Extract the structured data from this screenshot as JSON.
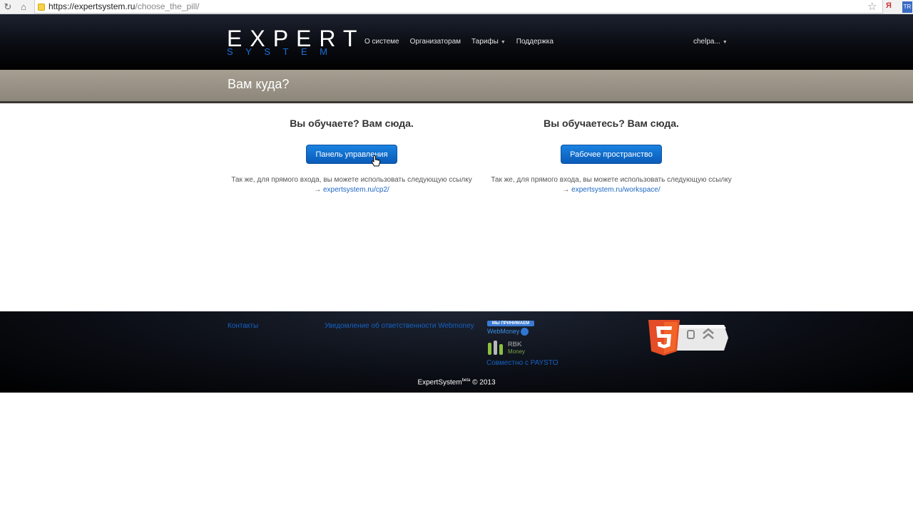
{
  "browser": {
    "url_host": "https://expertsystem.ru",
    "url_path": "/choose_the_pill/",
    "ext1": "Я",
    "ext2": "TR"
  },
  "header": {
    "logo_top": "EXPERT",
    "logo_bottom": "SYSTEM",
    "nav": [
      "О системе",
      "Организаторам",
      "Тарифы",
      "Поддержка"
    ],
    "user": "chelpa..."
  },
  "band": {
    "title": "Вам куда?"
  },
  "main": {
    "left": {
      "heading": "Вы обучаете? Вам сюда.",
      "button": "Панель управления",
      "hint": "Так же, для прямого входа, вы можете использовать следующую ссылку",
      "link": "expertsystem.ru/cp2/"
    },
    "right": {
      "heading": "Вы обучаетесь? Вам сюда.",
      "button": "Рабочее пространство",
      "hint": "Так же, для прямого входа, вы можете использовать следующую ссылку",
      "link": "expertsystem.ru/workspace/"
    },
    "arrow": "→"
  },
  "footer": {
    "contacts": "Контакты",
    "notice": "Уведомление об ответственности Webmoney",
    "wm_top": "МЫ ПРИНИМАЕМ",
    "wm_bottom": "WebMoney",
    "rbk_title": "RBK",
    "rbk_sub": "Money",
    "paysto": "Совместно с PAYSTO",
    "copyright_name": "ExpertSystem",
    "copyright_sup": "beta",
    "copyright_year": "© 2013"
  },
  "colors": {
    "accent": "#1a82e0",
    "link": "#1b67c4"
  }
}
